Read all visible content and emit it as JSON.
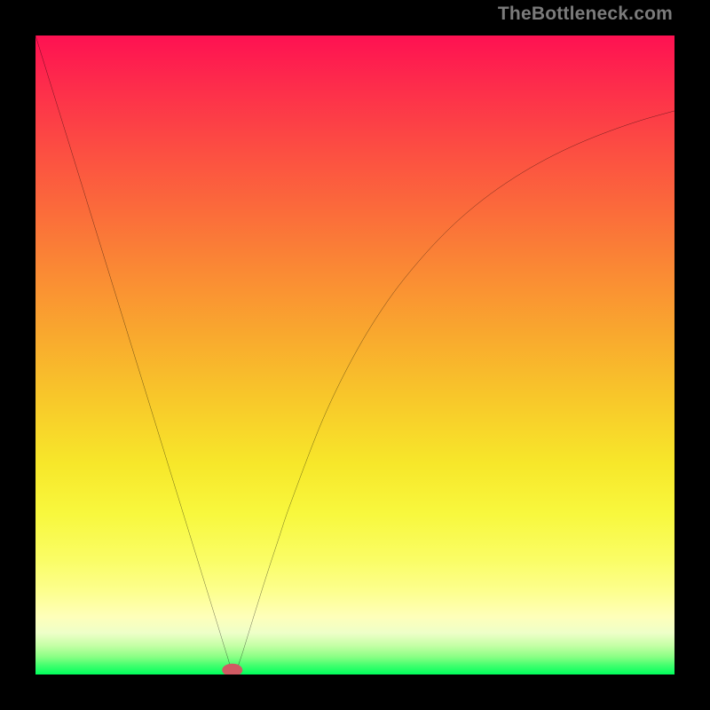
{
  "watermark": "TheBottleneck.com",
  "chart_data": {
    "type": "line",
    "title": "",
    "xlabel": "",
    "ylabel": "",
    "xlim": [
      0,
      100
    ],
    "ylim": [
      0,
      100
    ],
    "grid": false,
    "legend": false,
    "background_gradient": {
      "direction": "vertical",
      "stops": [
        {
          "pos": 0,
          "color": "#fe1152"
        },
        {
          "pos": 50,
          "color": "#f9b82c"
        },
        {
          "pos": 75,
          "color": "#f8f83e"
        },
        {
          "pos": 100,
          "color": "#00ff5c"
        }
      ]
    },
    "series": [
      {
        "name": "bottleneck-curve",
        "stroke": "#000000",
        "stroke_width": 2,
        "x": [
          0,
          5,
          10,
          15,
          20,
          25,
          28,
          30,
          31,
          32,
          34,
          36,
          38,
          40,
          45,
          50,
          55,
          60,
          65,
          70,
          75,
          80,
          85,
          90,
          95,
          100
        ],
        "values": [
          100,
          83.9,
          67.7,
          51.5,
          35.3,
          19.1,
          9.4,
          2.9,
          0.0,
          2.2,
          8.6,
          15.0,
          21.1,
          27.0,
          40.0,
          50.2,
          58.3,
          64.7,
          70.0,
          74.3,
          77.8,
          80.7,
          83.1,
          85.1,
          86.8,
          88.2
        ]
      }
    ],
    "marker": {
      "name": "min-point-marker",
      "x": 30.8,
      "y": 0.7,
      "rx": 1.6,
      "ry": 1.0,
      "fill": "#d15a63"
    }
  }
}
